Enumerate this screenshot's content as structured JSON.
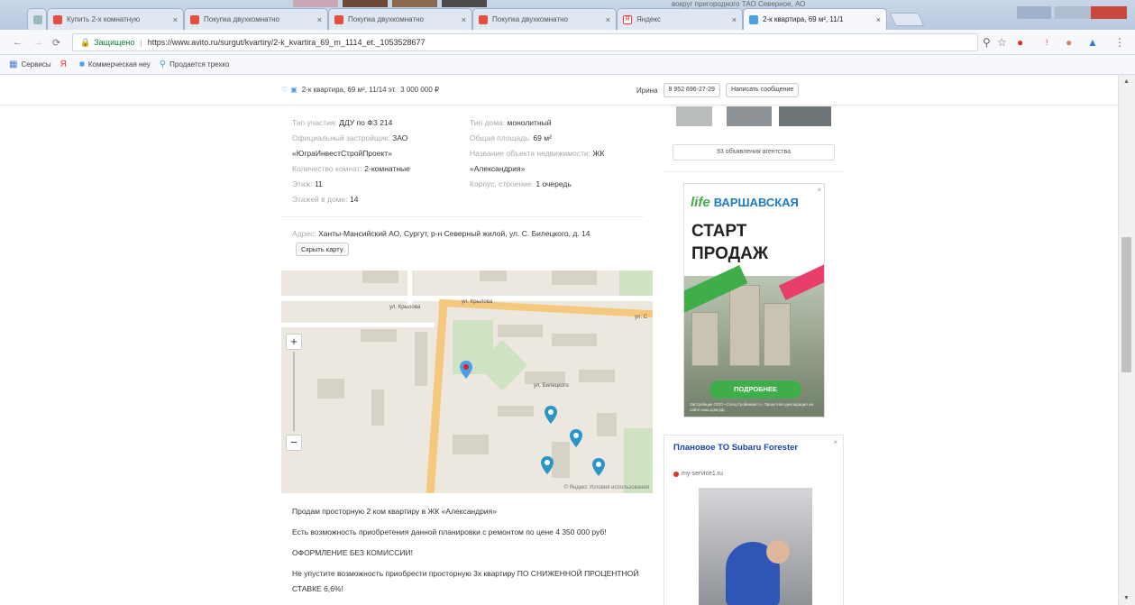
{
  "browser": {
    "top_strip_text": "вокруг пригородного ТАО Северное, АО",
    "tabs": [
      {
        "label": "Купить 2-х комнатную",
        "favicon": "avito-icon",
        "color": "#e84c3d",
        "active": false
      },
      {
        "label": "Покупка двухкомнатно",
        "favicon": "avito-icon",
        "color": "#e84c3d",
        "active": false
      },
      {
        "label": "Покупка двухкомнатно",
        "favicon": "avito-icon",
        "color": "#e84c3d",
        "active": false
      },
      {
        "label": "Покупка двухкомнатно",
        "favicon": "avito-icon",
        "color": "#e84c3d",
        "active": false
      },
      {
        "label": "Яндекс",
        "favicon": "yandex-icon",
        "color": "#f33",
        "active": false
      },
      {
        "label": "2-к квартира, 69 м², 11/1",
        "favicon": "avito-icon",
        "color": "#4aa0e6",
        "active": true
      }
    ],
    "address_bar": {
      "secure_label": "Защищено",
      "url": "https://www.avito.ru/surgut/kvartiry/2-k_kvartira_69_m_1114_et._1053528677"
    },
    "bookmarks": [
      {
        "label": "Сервисы",
        "icon": "apps-icon"
      },
      {
        "label": "",
        "icon": "yandex-icon"
      },
      {
        "label": "Коммерческая неу",
        "icon": "avito-icon"
      },
      {
        "label": "Продается трехко",
        "icon": "location-icon"
      }
    ]
  },
  "sticky_bar": {
    "listing_title": "2-к квартира, 69 м², 11/14 эт.",
    "price": "3 000 000 ₽",
    "seller_name": "Ирина",
    "phone": "8 952 696-27-29",
    "message_button": "Написать сообщение"
  },
  "params": {
    "left": [
      {
        "label": "Тип участия:",
        "value": "ДДУ по ФЗ 214"
      },
      {
        "label": "Официальный застройщик:",
        "value": "ЗАО «ЮграИнвестСтройПроект»"
      },
      {
        "label": "Количество комнат:",
        "value": "2-комнатные"
      },
      {
        "label": "Этаж:",
        "value": "11"
      },
      {
        "label": "Этажей в доме:",
        "value": "14"
      }
    ],
    "right": [
      {
        "label": "Тип дома:",
        "value": "монолитный"
      },
      {
        "label": "Общая площадь:",
        "value": "69 м²"
      },
      {
        "label": "Название объекта недвижимости:",
        "value": "ЖК «Александрия»"
      },
      {
        "label": "Корпус, строение:",
        "value": "1 очередь"
      }
    ]
  },
  "address": {
    "label": "Адрес:",
    "value": "Ханты-Мансийский АО, Сургут, р-н Северный жилой, ул. С. Билецкого, д. 14",
    "hide_map_button": "Скрыть карту"
  },
  "map": {
    "streets": [
      "ул. Крылова",
      "ул. Крылова",
      "ул. С",
      "ул. Билецкого"
    ],
    "zoom_in": "+",
    "zoom_out": "−",
    "footer": "© Яндекс  Условия использования"
  },
  "description": {
    "paragraphs": [
      "Продам просторную 2 ком квартиру в ЖК «Александрия»",
      "Есть возможность приобретения данной планировки с ремонтом по цене 4 350 000 руб!",
      "ОФОРМЛЕНИЕ БЕЗ КОМИССИИ!",
      "Не упустите возможность приобрести просторную 3х квартиру ПО СНИЖЕННОЙ ПРОЦЕНТНОЙ СТАВКЕ 6,6%!"
    ]
  },
  "sidebar": {
    "all_listings_button": "93 объявления агентства"
  },
  "ad1": {
    "brand": "life",
    "brand_sub": "ВАРШАВСКАЯ",
    "headline_1": "СТАРТ",
    "headline_2": "ПРОДАЖ",
    "cta": "ПОДРОБНЕЕ",
    "fine_print": "Застройщик ООО «Спецстройинвест». Проектная декларация на сайте наш.дом.рф",
    "close": "×"
  },
  "ad2": {
    "title": "Плановое ТО Subaru Forester",
    "domain": "my-service1.ru",
    "close": "×"
  },
  "colors": {
    "avito_blue": "#4aa0e6",
    "ad_green": "#3fae4a",
    "ad_pink": "#e83e6c",
    "ad_title_blue": "#1a3fb0"
  }
}
